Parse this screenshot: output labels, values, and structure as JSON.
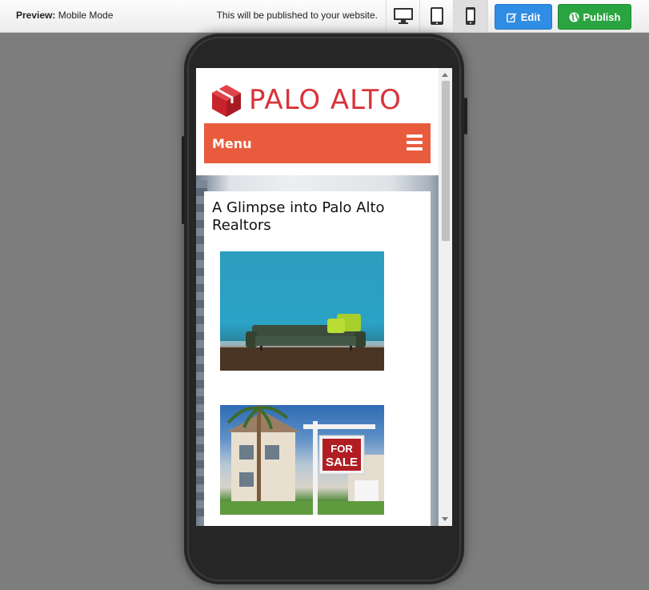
{
  "toolbar": {
    "preview_label": "Preview:",
    "mode": "Mobile Mode",
    "publish_note": "This will be published to your website.",
    "devices": [
      {
        "name": "desktop-icon",
        "active": false
      },
      {
        "name": "tablet-icon",
        "active": false
      },
      {
        "name": "mobile-icon",
        "active": true
      }
    ],
    "edit_label": "Edit",
    "publish_label": "Publish",
    "colors": {
      "edit": "#2f8de4",
      "publish": "#2aa440"
    }
  },
  "site": {
    "logo_text": "PALO ALTO",
    "logo_color": "#d9343b",
    "menu_label": "Menu",
    "menu_color": "#e85c3d",
    "article_title": "A Glimpse into Palo Alto Realtors",
    "images": [
      {
        "name": "living-room-sofa-photo"
      },
      {
        "name": "for-sale-sign-photo",
        "sign_line1": "FOR",
        "sign_line2": "SALE"
      }
    ]
  }
}
